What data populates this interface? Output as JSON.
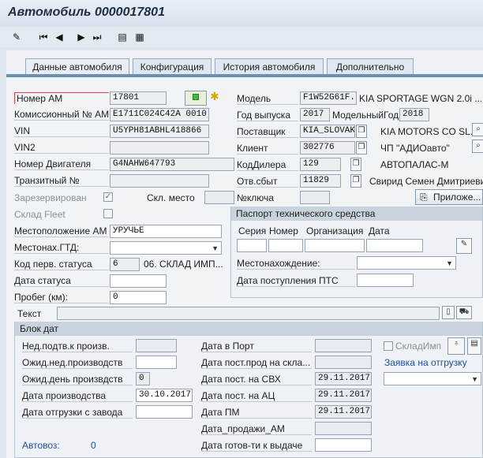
{
  "window": {
    "title": "Автомобиль 0000017801"
  },
  "toolbar": {
    "icons": [
      "edit-icon",
      "first-icon",
      "prev-icon",
      "next-icon",
      "last-icon",
      "doc-icon",
      "table-icon"
    ]
  },
  "tabs": [
    "Данные автомобиля",
    "Конфигурация",
    "История автомобиля",
    "Дополнительно"
  ],
  "fields": {
    "nomer_am_label": "Номер АМ",
    "nomer_am": "17801",
    "kom_label": "Комиссионный № АМ",
    "kom": "E1711C024C42A 0010",
    "vin_label": "VIN",
    "vin": "U5YPH81ABHL418866",
    "vin2_label": "VIN2",
    "engine_label": "Номер Двигателя",
    "engine": "G4NAHW647793",
    "transit_label": "Транзитный №",
    "reserved_label": "Зарезервирован",
    "skl_mesto_label": "Скл. место",
    "sklad_fleet_label": "Склад Fleet",
    "location_label": "Местоположение АМ",
    "location": "УРУЧЬЕ",
    "mestonah_gtd_label": "Местонах.ГТД:",
    "first_status_label": "Код перв. статуса",
    "first_status": "6",
    "first_status_text": "06. СКЛАД ИМП...",
    "status_date_label": "Дата статуса",
    "mileage_label": "Пробег (км):",
    "mileage": "0",
    "text_label": "Текст",
    "model_label": "Модель",
    "model": "F1W52G61F...",
    "model_text": "KIA SPORTAGE WGN 2.0i ...",
    "year_label": "Год выпуска",
    "year": "2017",
    "model_year_label": "МодельныйГод",
    "model_year": "2018",
    "supplier_label": "Поставщик",
    "supplier": "KIA_SLOVAK",
    "supplier_text": "KIA MOTORS CO SL...",
    "client_label": "Клиент",
    "client": "302776",
    "client_text": "ЧП \"АДИОавто\"",
    "dealer_label": "КодДилера",
    "dealer": "129",
    "dealer_text": "АВТОПАЛАС-М",
    "resp_label": "Отв.сбыт",
    "resp": "11829",
    "resp_text": "Свирид Семен Дмитриеви...",
    "key_label": "№ключа",
    "attach_button": "Приложе..."
  },
  "passport": {
    "title": "Паспорт технического средства",
    "cols": [
      "Серия",
      "Номер",
      "Организация",
      "Дата"
    ],
    "location_label": "Местонахождение:",
    "arrival_label": "Дата поступления ПТС"
  },
  "dates": {
    "title": "Блок дат",
    "left": [
      {
        "label": "Нед.подтв.к произв.",
        "value": ""
      },
      {
        "label": "Ожид.нед.производств",
        "value": ""
      },
      {
        "label": "Ожид.день произвдств",
        "value": "0"
      },
      {
        "label": "Дата производства",
        "value": "30.10.2017"
      },
      {
        "label": "Дата отгрузки с завода",
        "value": ""
      }
    ],
    "right": [
      {
        "label": "Дата в Порт",
        "value": ""
      },
      {
        "label": "Дата пост.прод на скла...",
        "value": ""
      },
      {
        "label": "Дата пост. на СВХ",
        "value": "29.11.2017"
      },
      {
        "label": "Дата пост. на АЦ",
        "value": "29.11.2017"
      },
      {
        "label": "Дата ПМ",
        "value": "29.11.2017"
      },
      {
        "label": "Дата_продажи_АМ",
        "value": ""
      },
      {
        "label": "Дата готов-ти к выдаче",
        "value": ""
      }
    ],
    "sklad_imp_label": "СкладИмп",
    "shipment_request_label": "Заявка на отгрузку",
    "avtovoz_label": "Автовоз:",
    "avtovoz_value": "0"
  }
}
